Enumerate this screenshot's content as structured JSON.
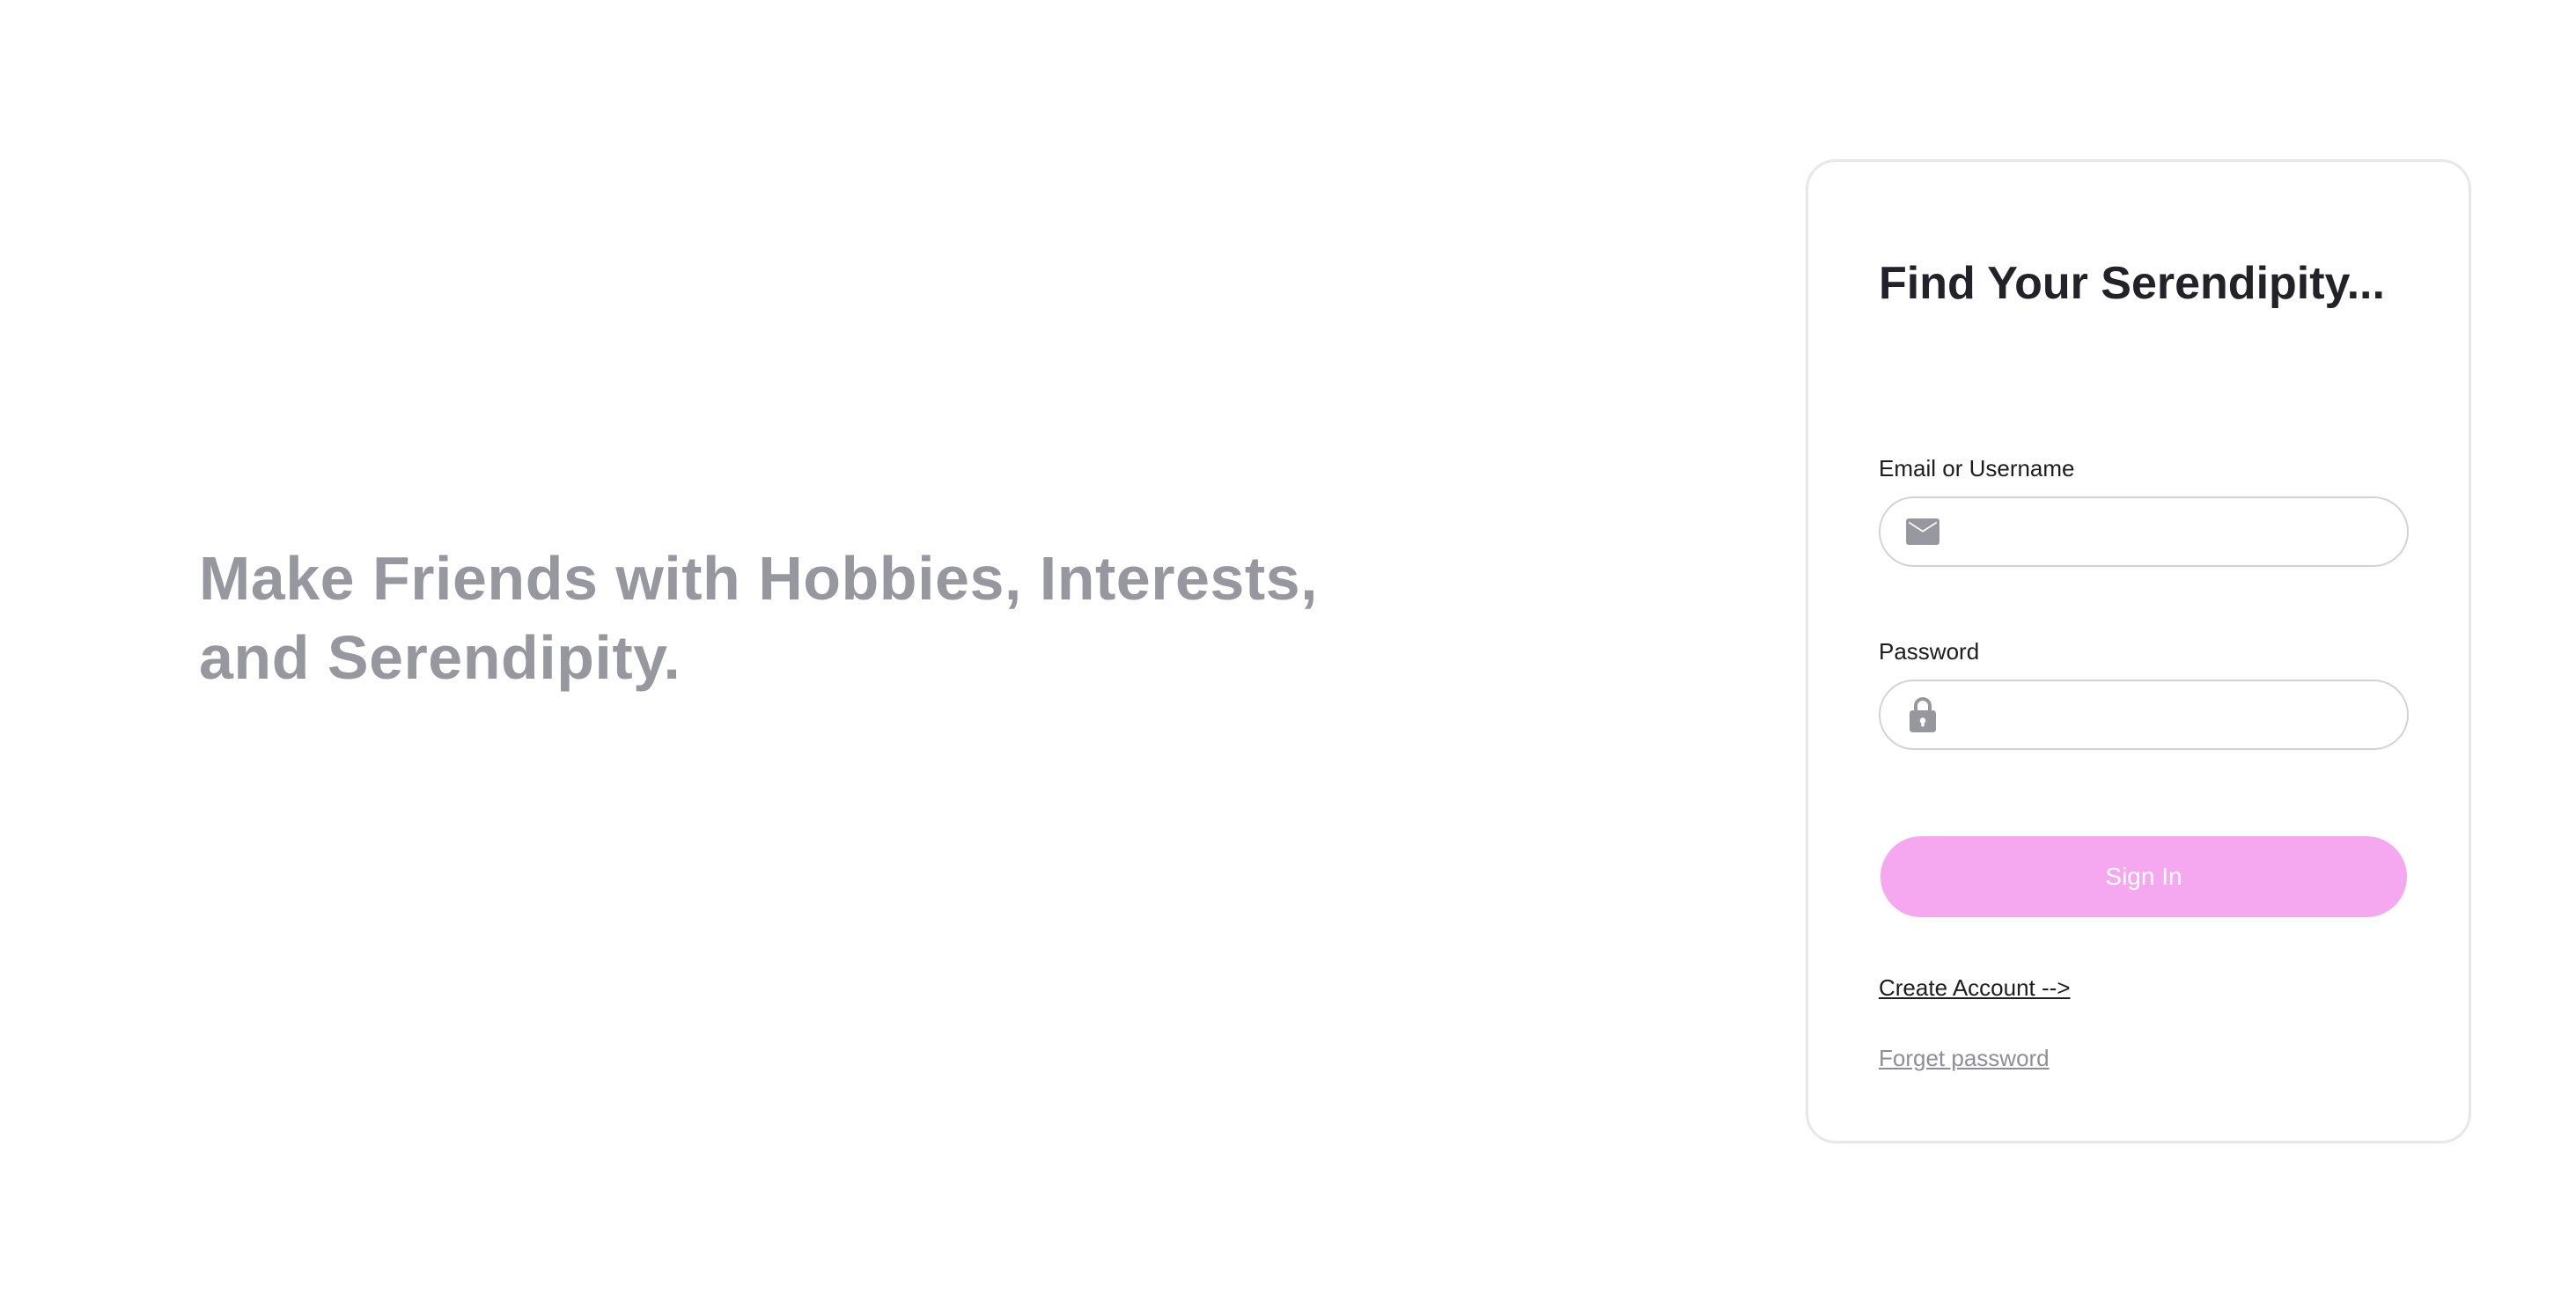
{
  "hero": {
    "tagline": "Make Friends with Hobbies, Interests, and Serendipity."
  },
  "login_card": {
    "title": "Find Your Serendipity...",
    "email_label": "Email or Username",
    "email_value": "",
    "email_icon": "mail-icon",
    "password_label": "Password",
    "password_value": "",
    "password_icon": "lock-icon",
    "signin_label": "Sign In",
    "create_account_label": "Create Account -->",
    "forgot_password_label": "Forget password"
  },
  "colors": {
    "tagline": "#97979f",
    "signin_button_bg": "#f5a8f0",
    "signin_button_text": "#ffffff",
    "icon": "#97979f",
    "card_border": "#e8e8ea"
  }
}
